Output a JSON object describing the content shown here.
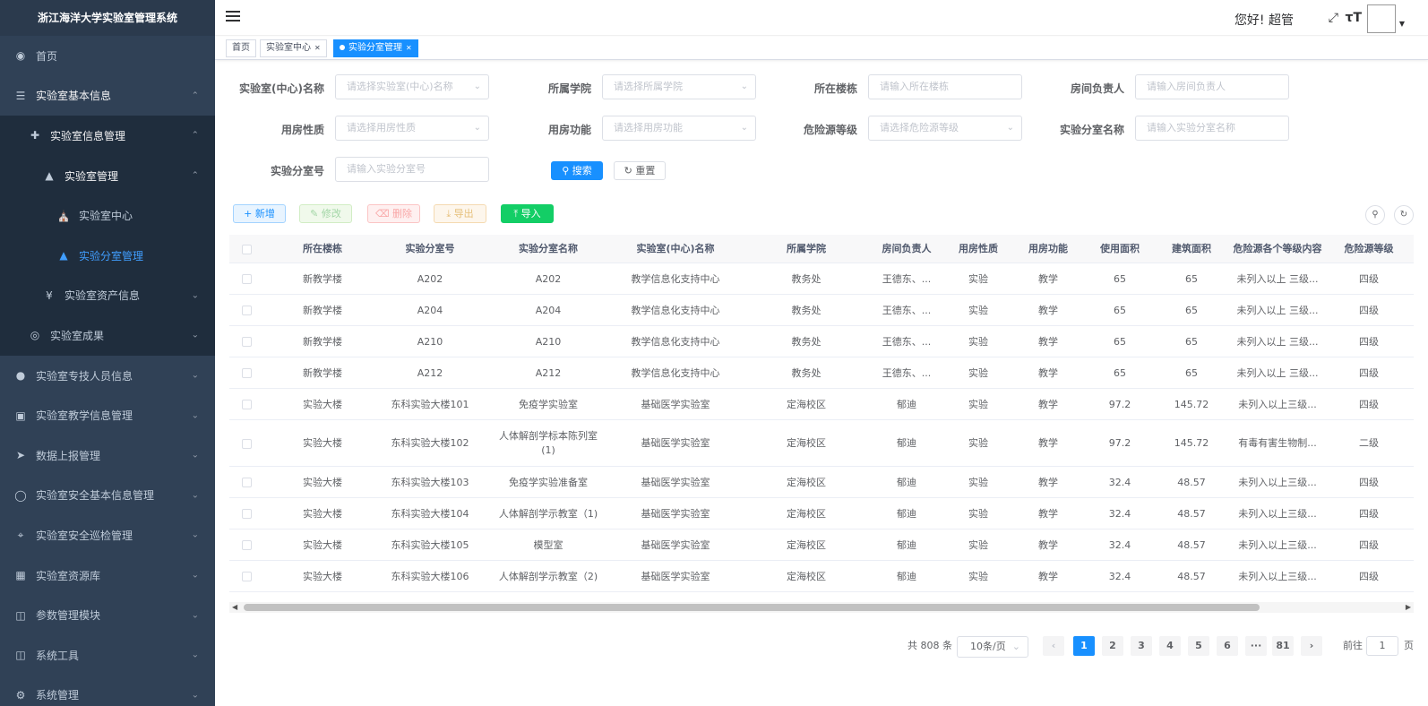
{
  "app": {
    "title": "浙江海洋大学实验室管理系统"
  },
  "sidebar": {
    "items": [
      {
        "label": "首页",
        "icon": "dashboard-icon"
      },
      {
        "label": "实验室基本信息",
        "icon": "list-icon"
      },
      {
        "label": "实验室信息管理",
        "icon": "move-icon"
      },
      {
        "label": "实验室管理",
        "icon": "tree-icon"
      },
      {
        "label": "实验室中心",
        "icon": "building-icon"
      },
      {
        "label": "实验分室管理",
        "icon": "tree-icon"
      },
      {
        "label": "实验室资产信息",
        "icon": "yen-icon"
      },
      {
        "label": "实验室成果",
        "icon": "award-icon"
      },
      {
        "label": "实验室专技人员信息",
        "icon": "user-icon"
      },
      {
        "label": "实验室教学信息管理",
        "icon": "book-icon"
      },
      {
        "label": "数据上报管理",
        "icon": "send-icon"
      },
      {
        "label": "实验室安全基本信息管理",
        "icon": "shield-icon"
      },
      {
        "label": "实验室安全巡检管理",
        "icon": "target-icon"
      },
      {
        "label": "实验室资源库",
        "icon": "grid-icon"
      },
      {
        "label": "参数管理模块",
        "icon": "panel-icon"
      },
      {
        "label": "系统工具",
        "icon": "tool-icon"
      },
      {
        "label": "系统管理",
        "icon": "gear-icon"
      }
    ]
  },
  "header": {
    "greeting": "您好! 超管"
  },
  "tags": [
    {
      "label": "首页"
    },
    {
      "label": "实验室中心"
    },
    {
      "label": "实验分室管理"
    }
  ],
  "filters": [
    {
      "label": "实验室(中心)名称",
      "placeholder": "请选择实验室(中心)名称",
      "type": "select"
    },
    {
      "label": "所属学院",
      "placeholder": "请选择所属学院",
      "type": "select"
    },
    {
      "label": "所在楼栋",
      "placeholder": "请输入所在楼栋",
      "type": "input"
    },
    {
      "label": "房间负责人",
      "placeholder": "请输入房间负责人",
      "type": "input"
    },
    {
      "label": "用房性质",
      "placeholder": "请选择用房性质",
      "type": "select"
    },
    {
      "label": "用房功能",
      "placeholder": "请选择用房功能",
      "type": "select"
    },
    {
      "label": "危险源等级",
      "placeholder": "请选择危险源等级",
      "type": "select"
    },
    {
      "label": "实验分室名称",
      "placeholder": "请输入实验分室名称",
      "type": "input"
    },
    {
      "label": "实验分室号",
      "placeholder": "请输入实验分室号",
      "type": "input"
    }
  ],
  "buttons": {
    "search": "搜索",
    "reset": "重置",
    "add": "新增",
    "edit": "修改",
    "delete": "删除",
    "export": "导出",
    "import": "导入"
  },
  "table": {
    "columns": [
      "所在楼栋",
      "实验分室号",
      "实验分室名称",
      "实验室(中心)名称",
      "所属学院",
      "房间负责人",
      "用房性质",
      "用房功能",
      "使用面积",
      "建筑面积",
      "危险源各个等级内容",
      "危险源等级"
    ],
    "rows": [
      [
        "新教学楼",
        "A202",
        "A202",
        "教学信息化支持中心",
        "教务处",
        "王德东、...",
        "实验",
        "教学",
        "65",
        "65",
        "未列入以上 三级...",
        "四级"
      ],
      [
        "新教学楼",
        "A204",
        "A204",
        "教学信息化支持中心",
        "教务处",
        "王德东、...",
        "实验",
        "教学",
        "65",
        "65",
        "未列入以上 三级...",
        "四级"
      ],
      [
        "新教学楼",
        "A210",
        "A210",
        "教学信息化支持中心",
        "教务处",
        "王德东、...",
        "实验",
        "教学",
        "65",
        "65",
        "未列入以上 三级...",
        "四级"
      ],
      [
        "新教学楼",
        "A212",
        "A212",
        "教学信息化支持中心",
        "教务处",
        "王德东、...",
        "实验",
        "教学",
        "65",
        "65",
        "未列入以上 三级...",
        "四级"
      ],
      [
        "实验大楼",
        "东科实验大楼101",
        "免疫学实验室",
        "基础医学实验室",
        "定海校区",
        "郁迪",
        "实验",
        "教学",
        "97.2",
        "145.72",
        "未列入以上三级...",
        "四级"
      ],
      [
        "实验大楼",
        "东科实验大楼102",
        "人体解剖学标本陈列室(1)",
        "基础医学实验室",
        "定海校区",
        "郁迪",
        "实验",
        "教学",
        "97.2",
        "145.72",
        "有毒有害生物制...",
        "二级"
      ],
      [
        "实验大楼",
        "东科实验大楼103",
        "免疫学实验准备室",
        "基础医学实验室",
        "定海校区",
        "郁迪",
        "实验",
        "教学",
        "32.4",
        "48.57",
        "未列入以上三级...",
        "四级"
      ],
      [
        "实验大楼",
        "东科实验大楼104",
        "人体解剖学示教室（1)",
        "基础医学实验室",
        "定海校区",
        "郁迪",
        "实验",
        "教学",
        "32.4",
        "48.57",
        "未列入以上三级...",
        "四级"
      ],
      [
        "实验大楼",
        "东科实验大楼105",
        "模型室",
        "基础医学实验室",
        "定海校区",
        "郁迪",
        "实验",
        "教学",
        "32.4",
        "48.57",
        "未列入以上三级...",
        "四级"
      ],
      [
        "实验大楼",
        "东科实验大楼106",
        "人体解剖学示教室（2)",
        "基础医学实验室",
        "定海校区",
        "郁迪",
        "实验",
        "教学",
        "32.4",
        "48.57",
        "未列入以上三级...",
        "四级"
      ]
    ]
  },
  "pagination": {
    "total": "共 808 条",
    "page_size": "10条/页",
    "pages": [
      "1",
      "2",
      "3",
      "4",
      "5",
      "6",
      "···",
      "81"
    ],
    "current": "1",
    "goto_label": "前往",
    "goto_value": "1",
    "page_suffix": "页"
  },
  "colors": {
    "sidebar_bg": "#304156",
    "primary": "#1890ff",
    "success": "#13ce66"
  }
}
